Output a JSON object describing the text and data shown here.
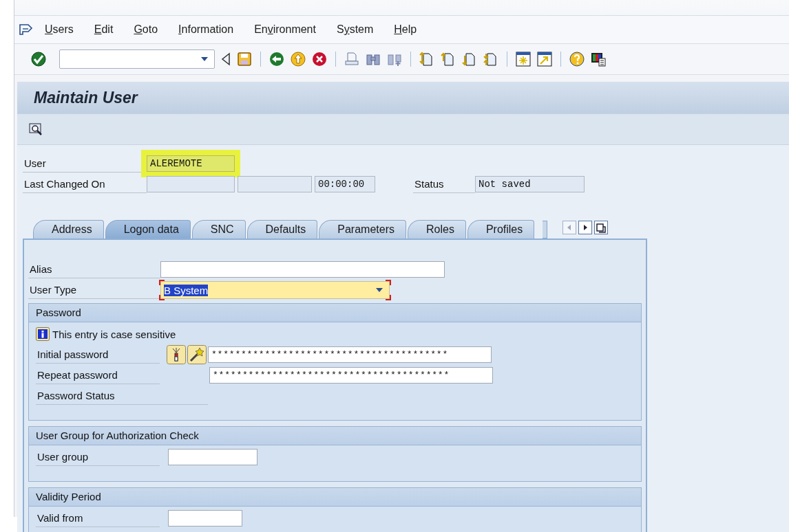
{
  "menu": [
    {
      "key": "U",
      "after": "sers"
    },
    {
      "key": "E",
      "after": "dit"
    },
    {
      "key": "G",
      "after": "oto"
    },
    {
      "key": "I",
      "after": "nformation"
    },
    {
      "before": "En",
      "key": "v",
      "after": "ironment"
    },
    {
      "before": "S",
      "key": "y",
      "after": "stem"
    },
    {
      "key": "H",
      "after": "elp"
    }
  ],
  "title": "Maintain User",
  "header": {
    "user": {
      "label": "User",
      "value": "ALEREMOTE",
      "highlighted": true
    },
    "last_changed": {
      "label": "Last Changed On",
      "time": "00:00:00"
    },
    "status": {
      "label": "Status",
      "value": "Not saved"
    }
  },
  "tabs": [
    {
      "label": "Address",
      "selected": false
    },
    {
      "label": "Logon data",
      "selected": true
    },
    {
      "label": "SNC",
      "selected": false
    },
    {
      "label": "Defaults",
      "selected": false
    },
    {
      "label": "Parameters",
      "selected": false
    },
    {
      "label": "Roles",
      "selected": false
    },
    {
      "label": "Profiles",
      "selected": false
    }
  ],
  "alias": {
    "label": "Alias"
  },
  "user_type": {
    "label": "User Type",
    "value": "B System",
    "text_selected": true
  },
  "groups": [
    {
      "title": "Password",
      "rows": [
        {
          "kind": "info",
          "text": "This entry is case sensitive"
        },
        {
          "kind": "password_tools",
          "label": "Initial password",
          "value": "****************************************"
        },
        {
          "kind": "password",
          "label": "Repeat password",
          "value": "****************************************"
        },
        {
          "kind": "label",
          "label": "Password Status"
        }
      ]
    },
    {
      "title": "User Group for Authorization Check",
      "rows": [
        {
          "kind": "short_field",
          "label": "User group"
        }
      ]
    },
    {
      "title": "Validity Period",
      "rows": [
        {
          "kind": "date_field",
          "label": "Valid from"
        }
      ]
    }
  ]
}
